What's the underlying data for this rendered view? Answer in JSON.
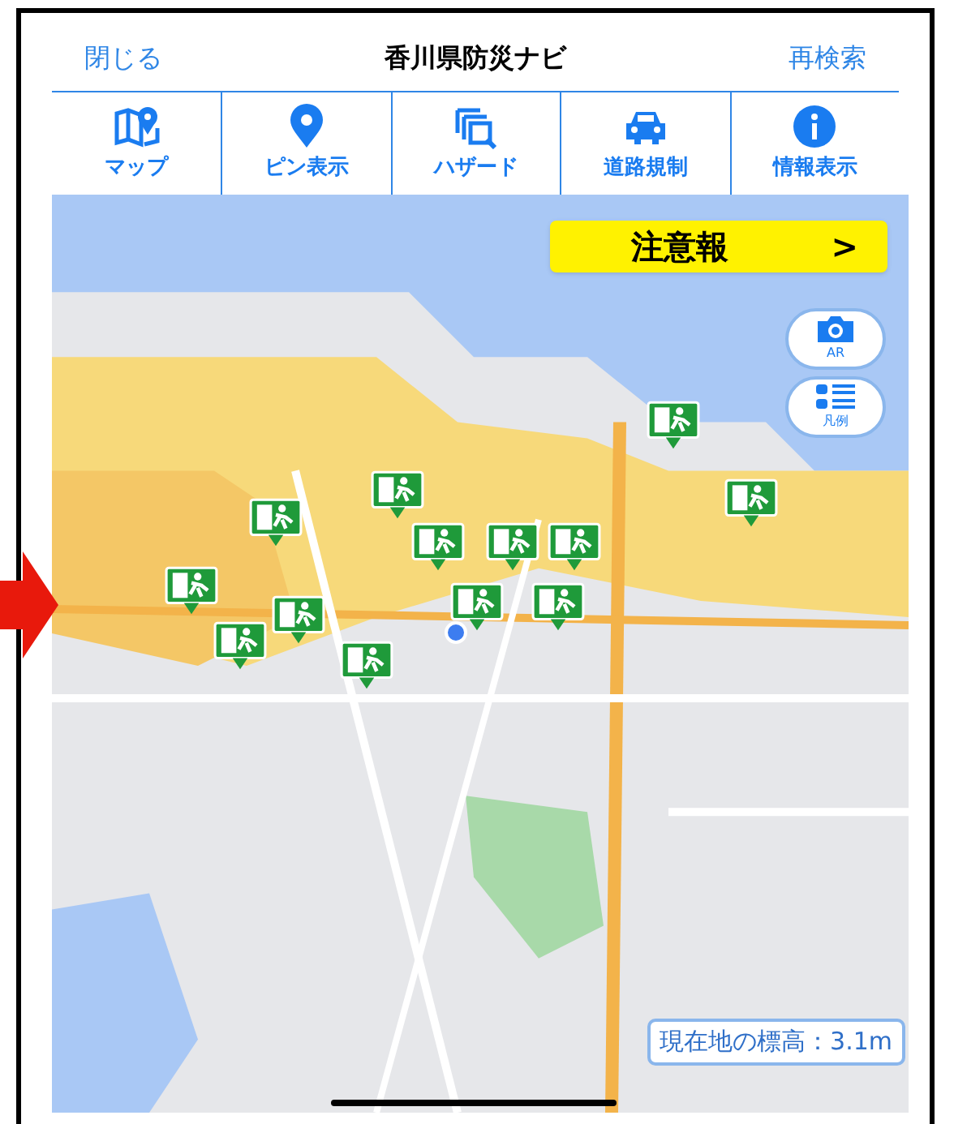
{
  "header": {
    "close": "閉じる",
    "title": "香川県防災ナビ",
    "research": "再検索"
  },
  "toolbar": [
    {
      "kind": "map",
      "label": "マップ"
    },
    {
      "kind": "pin",
      "label": "ピン表示"
    },
    {
      "kind": "hazard",
      "label": "ハザード"
    },
    {
      "kind": "road",
      "label": "道路規制"
    },
    {
      "kind": "info",
      "label": "情報表示"
    }
  ],
  "map": {
    "alert_button": "注意報",
    "alert_arrow": ">",
    "ar_button": "AR",
    "legend_button": "凡例",
    "elevation": "現在地の標高：3.1m"
  }
}
